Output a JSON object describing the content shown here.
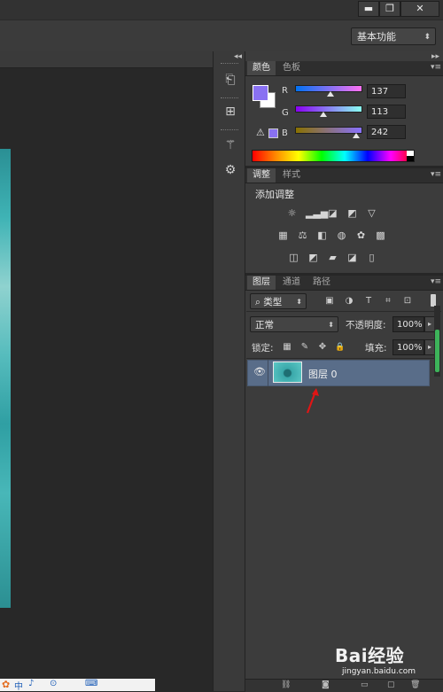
{
  "window": {
    "minimize_label": "▬",
    "restore_label": "❐",
    "close_label": "✕"
  },
  "options_bar": {
    "workspace": "基本功能"
  },
  "strip_icons": [
    "history-icon",
    "properties-icon",
    "brush-preset-icon",
    "tool-preset-icon"
  ],
  "color_panel": {
    "tabs": [
      "颜色",
      "色板"
    ],
    "channels": [
      {
        "label": "R",
        "value": "137"
      },
      {
        "label": "G",
        "value": "113"
      },
      {
        "label": "B",
        "value": "242"
      }
    ],
    "foreground": "#8971f2",
    "background": "#ffffff"
  },
  "adjustments_panel": {
    "tabs": [
      "调整",
      "样式"
    ],
    "title": "添加调整",
    "row1": [
      "☼",
      "▂▃▅",
      "◪",
      "◩",
      "▽"
    ],
    "row2": [
      "▦",
      "⚖",
      "◧",
      "◍",
      "✿",
      "▩"
    ],
    "row3": [
      "◫",
      "◩",
      "▰",
      "◪",
      "▯"
    ]
  },
  "layers_panel": {
    "tabs": [
      "图层",
      "通道",
      "路径"
    ],
    "filter_kind": "类型",
    "filter_icons": [
      "▣",
      "◑",
      "T",
      "⌗",
      "⊡"
    ],
    "blend_mode": "正常",
    "opacity_label": "不透明度:",
    "opacity_value": "100%",
    "lock_label": "锁定:",
    "lock_icons": [
      "▦",
      "✎",
      "✥",
      "🔒"
    ],
    "fill_label": "填充:",
    "fill_value": "100%",
    "layers": [
      {
        "name": "图层 0",
        "visible": true
      }
    ]
  },
  "watermark": {
    "brand": "Bai经验",
    "url": "jingyan.baidu.com"
  },
  "taskbar_icons": [
    "中",
    "♪",
    "⊙",
    "⌨"
  ]
}
